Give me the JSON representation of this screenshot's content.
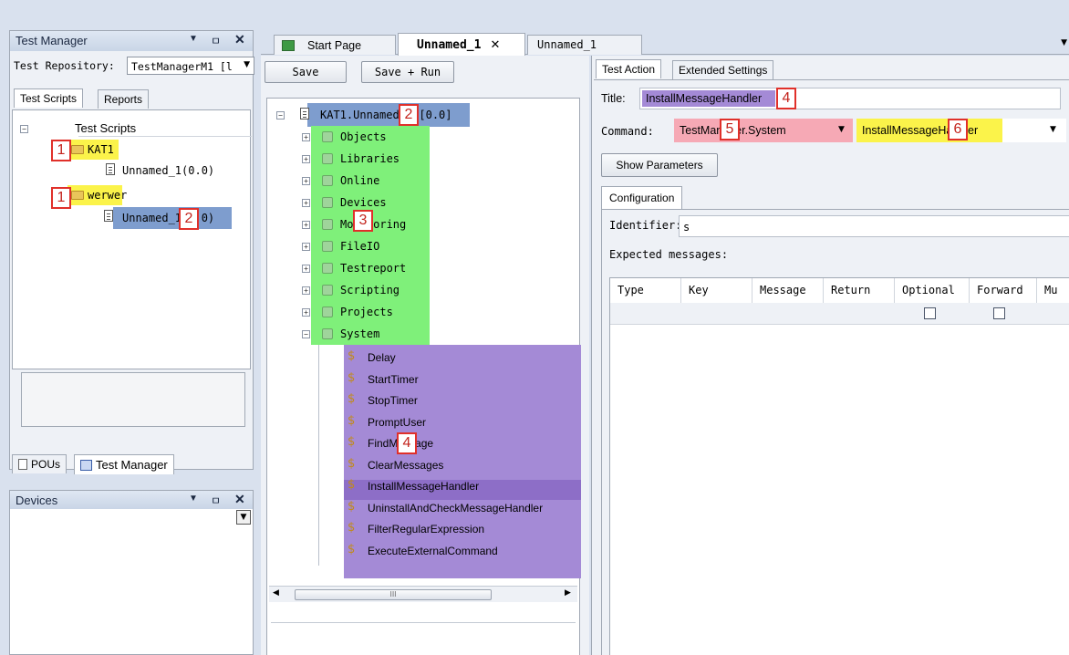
{
  "test_manager": {
    "title": "Test Manager",
    "repo_label": "Test Repository:",
    "repo_value": "TestManagerM1 [l",
    "tabs": [
      "Test Scripts",
      "Reports"
    ],
    "tree_root": "Test Scripts",
    "items": [
      {
        "label": "KAT1",
        "badge": "1"
      },
      {
        "label": "Unnamed_1(0.0)"
      },
      {
        "label": "werwer",
        "badge": "1"
      },
      {
        "label": "Unnamed_1(0.0)",
        "badge": "2"
      }
    ],
    "bottom_tabs": [
      "POUs",
      "Test Manager"
    ]
  },
  "devices": {
    "title": "Devices"
  },
  "editor_tabs": [
    "Start Page",
    "Unnamed_1",
    "Unnamed_1"
  ],
  "toolbar": {
    "save": "Save",
    "save_run": "Save + Run"
  },
  "script_tree": {
    "root": "KAT1.Unnamed_1 [0.0]",
    "root_badge": "2",
    "groups": [
      "Objects",
      "Libraries",
      "Online",
      "Devices",
      "Monitoring",
      "FileIO",
      "Testreport",
      "Scripting",
      "Projects",
      "System"
    ],
    "groups_badge": "3",
    "commands": [
      "Delay",
      "StartTimer",
      "StopTimer",
      "PromptUser",
      "FindMessage",
      "ClearMessages",
      "InstallMessageHandler",
      "UninstallAndCheckMessageHandler",
      "FilterRegularExpression",
      "ExecuteExternalCommand"
    ],
    "commands_badge": "4",
    "scroll_mid": "III"
  },
  "action": {
    "tabs": [
      "Test Action",
      "Extended Settings"
    ],
    "title_label": "Title:",
    "title_value": "InstallMessageHandler",
    "title_badge": "4",
    "command_label": "Command:",
    "command_category": "TestManager.System",
    "command_badge": "5",
    "command_name": "InstallMessageHandler",
    "command_name_badge": "6",
    "show_params": "Show Parameters",
    "config_tab": "Configuration",
    "identifier_label": "Identifier:",
    "identifier_value": "s",
    "expected_label": "Expected messages:",
    "columns": [
      "Type",
      "Key",
      "Message",
      "Return",
      "Optional",
      "Forward",
      "Mu"
    ]
  },
  "colors": {
    "yellow": "#fbf34a",
    "blue": "#7e9dce",
    "green": "#7ff07a",
    "purple": "#a48ad6",
    "pink": "#f6a9b5",
    "badge": "#e0302a"
  }
}
